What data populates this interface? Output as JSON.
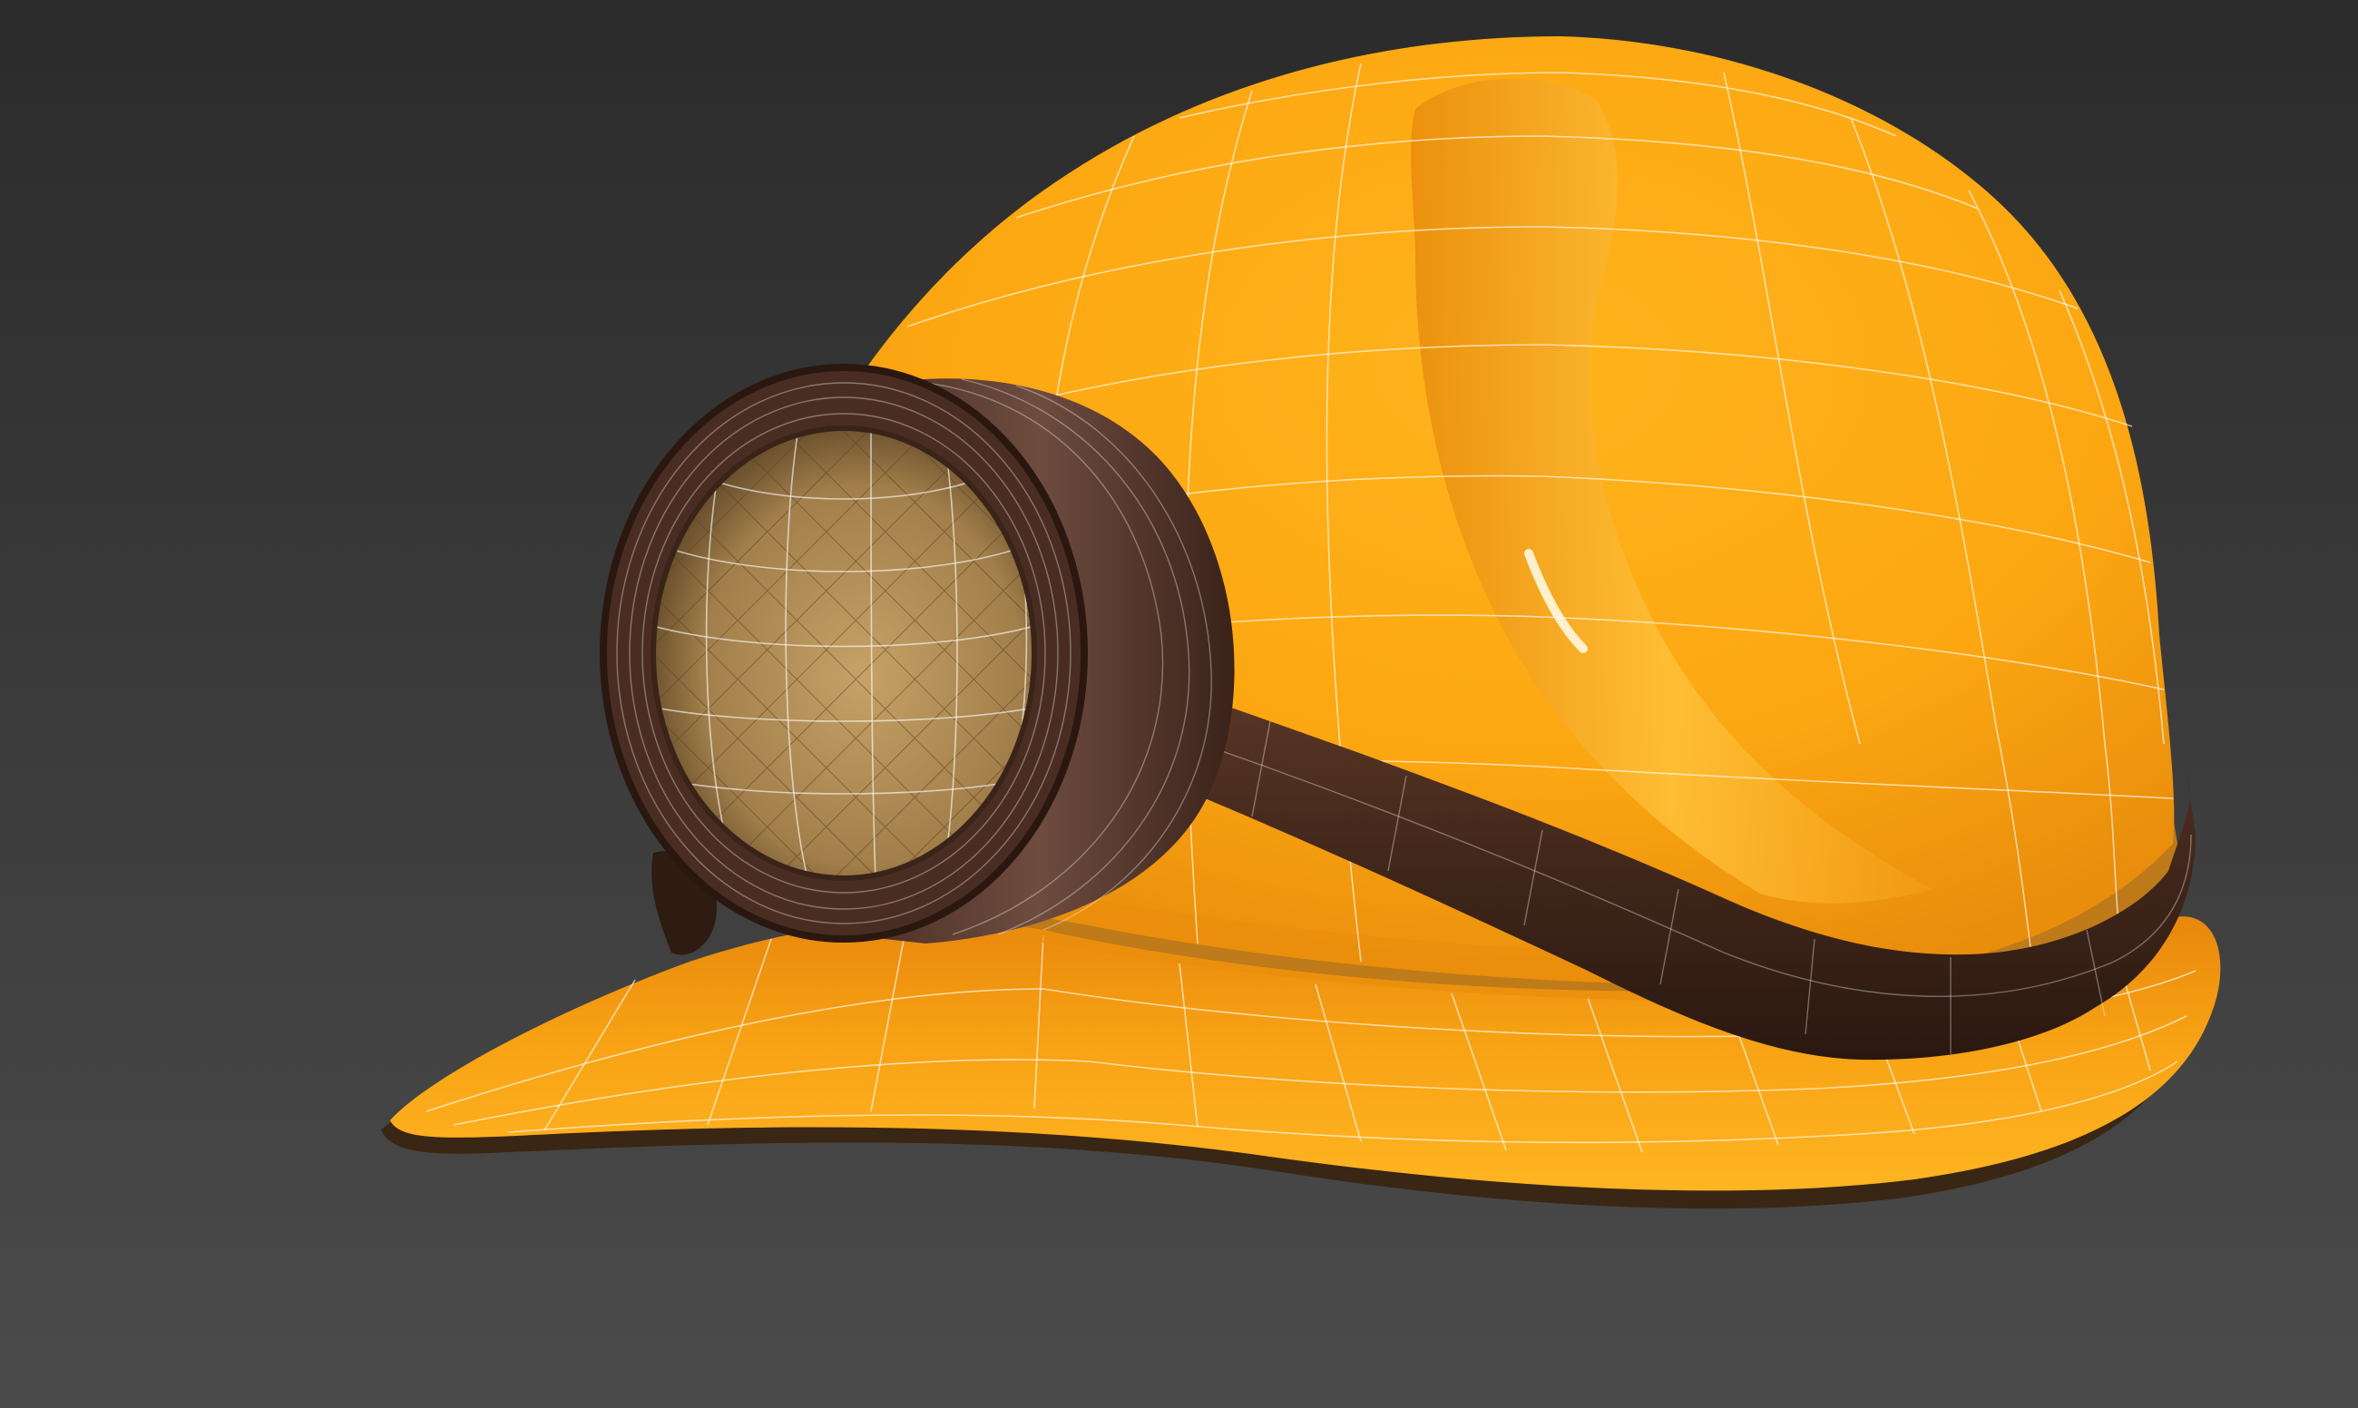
{
  "scene": {
    "subject": "helmet-with-headlamp",
    "background_top": "#2b2b2b",
    "background_bottom": "#4a4a4a",
    "colors": {
      "helmet_light": "#ffb21a",
      "helmet_mid": "#f7a10f",
      "helmet_dark": "#d8770a",
      "brim_under": "#3a2614",
      "strap": "#4a2c1e",
      "strap_dark": "#2e1b12",
      "lamp_rim_light": "#6a4a3e",
      "lamp_rim_dark": "#3a241b",
      "lens_light": "#c9a56a",
      "lens_dark": "#6e5330",
      "wireframe": "#ffffff"
    }
  }
}
